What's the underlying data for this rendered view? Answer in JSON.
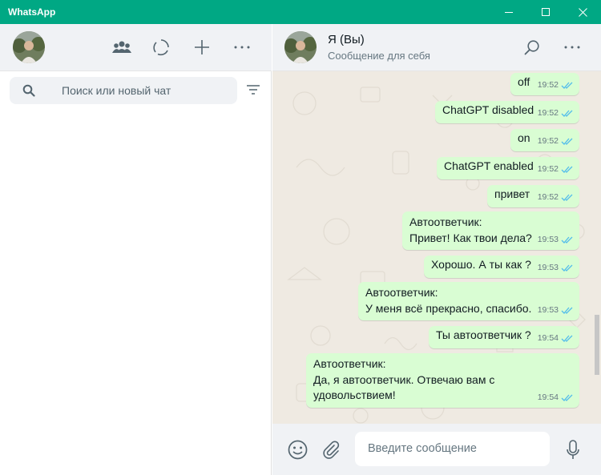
{
  "window": {
    "title": "WhatsApp",
    "accent": "#00a884"
  },
  "sidebar": {
    "search_placeholder": "Поиск или новый чат",
    "icons": [
      "avatar",
      "communities-icon",
      "status-icon",
      "new-chat-icon",
      "menu-icon",
      "search-icon",
      "filter-icon"
    ]
  },
  "chat": {
    "name": "Я (Вы)",
    "subtitle": "Сообщение для себя",
    "bubble_color": "#d9fdd3",
    "messages": [
      {
        "lines": [
          "off"
        ],
        "time": "19:52"
      },
      {
        "lines": [
          "ChatGPT disabled"
        ],
        "time": "19:52"
      },
      {
        "lines": [
          "on"
        ],
        "time": "19:52"
      },
      {
        "lines": [
          "ChatGPT enabled"
        ],
        "time": "19:52"
      },
      {
        "lines": [
          "привет"
        ],
        "time": "19:52"
      },
      {
        "lines": [
          "Автоответчик:",
          "Привет! Как твои дела?"
        ],
        "time": "19:53"
      },
      {
        "lines": [
          "Хорошо. А ты как ?"
        ],
        "time": "19:53"
      },
      {
        "lines": [
          "Автоответчик:",
          "У меня всё прекрасно, спасибо."
        ],
        "time": "19:53"
      },
      {
        "lines": [
          "Ты автоответчик ?"
        ],
        "time": "19:54"
      },
      {
        "lines": [
          "Автоответчик:",
          "Да, я автоответчик. Отвечаю вам с",
          "удовольствием!"
        ],
        "time": "19:54"
      }
    ]
  },
  "composer": {
    "placeholder": "Введите сообщение"
  }
}
